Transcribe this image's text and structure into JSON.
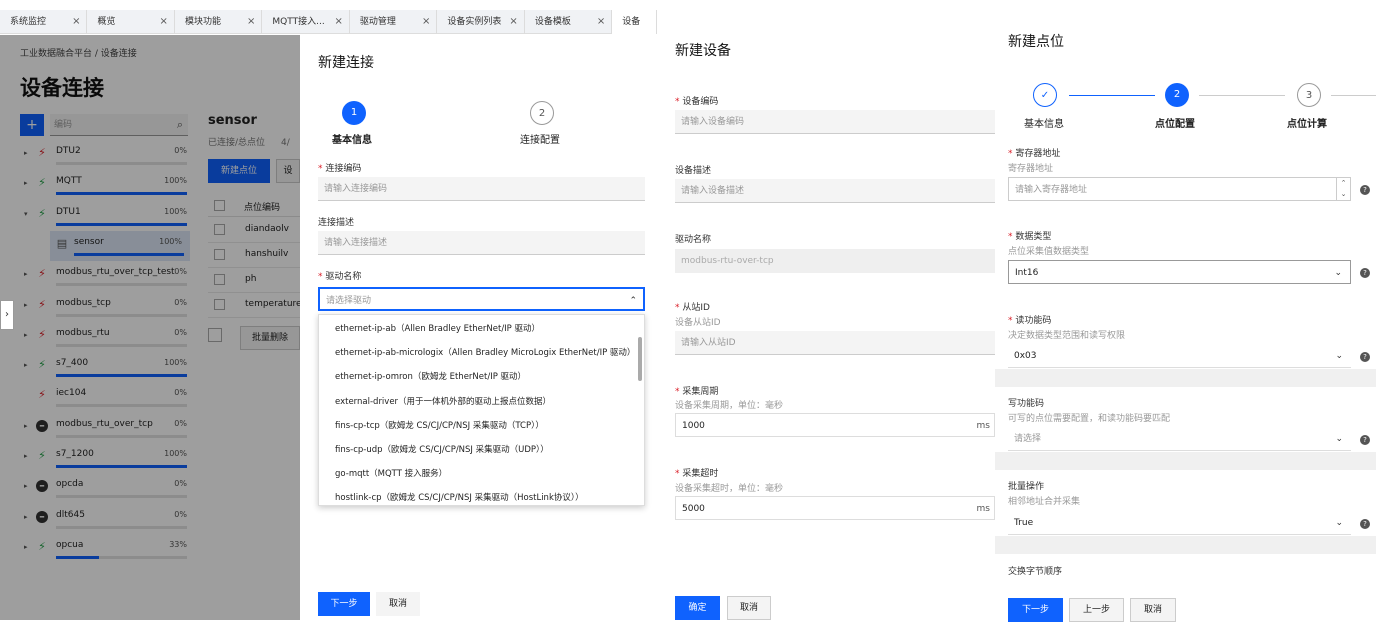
{
  "tabs": [
    {
      "label": "系统监控",
      "active": false
    },
    {
      "label": "概览",
      "active": false
    },
    {
      "label": "模块功能",
      "active": false
    },
    {
      "label": "MQTT接入...",
      "active": false
    },
    {
      "label": "驱动管理",
      "active": false
    },
    {
      "label": "设备实例列表",
      "active": false
    },
    {
      "label": "设备模板",
      "active": false
    },
    {
      "label": "设备",
      "active": true
    }
  ],
  "close_glyph": "×",
  "breadcrumb": "工业数据融合平台 / 设备连接",
  "page_title": "设备连接",
  "search": {
    "placeholder": "编码",
    "add_label": "+"
  },
  "tree": [
    {
      "name": "DTU2",
      "percent": "0%",
      "progress": 0,
      "status": "disconnected",
      "expand": true
    },
    {
      "name": "MQTT",
      "percent": "100%",
      "progress": 1,
      "status": "connected",
      "expand": true
    },
    {
      "name": "DTU1",
      "percent": "100%",
      "progress": 1,
      "status": "connected",
      "expand": true,
      "open": true
    },
    {
      "name": "sensor",
      "percent": "100%",
      "progress": 1,
      "status": "device",
      "expand": false,
      "child": true
    },
    {
      "name": "modbus_rtu_over_tcp_test",
      "percent": "0%",
      "progress": 0,
      "status": "disconnected",
      "expand": true
    },
    {
      "name": "modbus_tcp",
      "percent": "0%",
      "progress": 0,
      "status": "disconnected",
      "expand": true
    },
    {
      "name": "modbus_rtu",
      "percent": "0%",
      "progress": 0,
      "status": "disconnected",
      "expand": true
    },
    {
      "name": "s7_400",
      "percent": "100%",
      "progress": 1,
      "status": "connected",
      "expand": true
    },
    {
      "name": "iec104",
      "percent": "0%",
      "progress": 0,
      "status": "disconnected",
      "expand": false
    },
    {
      "name": "modbus_rtu_over_tcp",
      "percent": "0%",
      "progress": 0,
      "status": "stopped",
      "expand": true
    },
    {
      "name": "s7_1200",
      "percent": "100%",
      "progress": 1,
      "status": "connected",
      "expand": true
    },
    {
      "name": "opcda",
      "percent": "0%",
      "progress": 0,
      "status": "stopped",
      "expand": true
    },
    {
      "name": "dlt645",
      "percent": "0%",
      "progress": 0,
      "status": "stopped",
      "expand": true
    },
    {
      "name": "opcua",
      "percent": "33%",
      "progress": 0.33,
      "status": "connected",
      "expand": true
    }
  ],
  "detail": {
    "title": "sensor",
    "subtitle": "已连接/总点位",
    "count": "4/",
    "new_point_btn": "新建点位",
    "second_btn": "设",
    "col_header": "点位编码",
    "rows": [
      "diandaolv",
      "hanshuilv",
      "ph",
      "temperature"
    ],
    "batch_delete": "批量删除"
  },
  "drawer_new_connection": {
    "title": "新建连接",
    "steps": [
      {
        "num": "1",
        "label": "基本信息"
      },
      {
        "num": "2",
        "label": "连接配置"
      }
    ],
    "fields": [
      {
        "label": "连接编码",
        "required": true,
        "placeholder": "请输入连接编码"
      },
      {
        "label": "连接描述",
        "required": false,
        "placeholder": "请输入连接描述"
      },
      {
        "label": "驱动名称",
        "required": true,
        "placeholder": "请选择驱动"
      }
    ],
    "dropdown_options": [
      "ethernet-ip-ab（Allen Bradley EtherNet/IP 驱动）",
      "ethernet-ip-ab-micrologix（Allen Bradley MicroLogix EtherNet/IP 驱动）",
      "ethernet-ip-omron（欧姆龙 EtherNet/IP 驱动）",
      "external-driver（用于一体机外部的驱动上报点位数据）",
      "fins-cp-tcp（欧姆龙 CS/CJ/CP/NSJ 采集驱动（TCP））",
      "fins-cp-udp（欧姆龙 CS/CJ/CP/NSJ 采集驱动（UDP））",
      "go-mqtt（MQTT 接入服务）",
      "hostlink-cp（欧姆龙 CS/CJ/CP/NSJ 采集驱动（HostLink协议））"
    ],
    "next_btn": "下一步",
    "cancel_btn": "取消"
  },
  "drawer_new_device": {
    "title": "新建设备",
    "fields": [
      {
        "label": "设备编码",
        "required": true,
        "hint": "",
        "value": "",
        "placeholder": "请输入设备编码"
      },
      {
        "label": "设备描述",
        "required": false,
        "hint": "",
        "value": "",
        "placeholder": "请输入设备描述"
      },
      {
        "label": "驱动名称",
        "required": false,
        "hint": "",
        "value": "modbus-rtu-over-tcp",
        "placeholder": ""
      },
      {
        "label": "从站ID",
        "required": true,
        "hint": "设备从站ID",
        "value": "",
        "placeholder": "请输入从站ID"
      },
      {
        "label": "采集周期",
        "required": true,
        "hint": "设备采集周期，单位：毫秒",
        "value": "1000",
        "unit": "ms"
      },
      {
        "label": "采集超时",
        "required": true,
        "hint": "设备采集超时，单位：毫秒",
        "value": "5000",
        "unit": "ms"
      }
    ],
    "confirm_btn": "确定",
    "cancel_btn": "取消"
  },
  "drawer_new_point": {
    "title": "新建点位",
    "steps": [
      {
        "num": "✓",
        "label": "基本信息",
        "state": "done"
      },
      {
        "num": "2",
        "label": "点位配置",
        "state": "active"
      },
      {
        "num": "3",
        "label": "点位计算",
        "state": "todo"
      }
    ],
    "fields": [
      {
        "label": "寄存器地址",
        "required": true,
        "hint": "寄存器地址",
        "value": "",
        "placeholder": "请输入寄存器地址",
        "type": "number"
      },
      {
        "label": "数据类型",
        "required": true,
        "hint": "点位采集值数据类型",
        "value": "Int16",
        "type": "select"
      },
      {
        "label": "读功能码",
        "required": true,
        "hint": "决定数据类型范围和读写权限",
        "value": "0x03",
        "type": "select"
      },
      {
        "label": "写功能码",
        "required": false,
        "hint": "可写的点位需要配置，和读功能码要匹配",
        "value": "",
        "placeholder": "请选择",
        "type": "select"
      },
      {
        "label": "批量操作",
        "required": false,
        "hint": "相邻地址合并采集",
        "value": "True",
        "type": "select"
      },
      {
        "label": "交换字节顺序",
        "required": false,
        "hint": "",
        "value": "",
        "type": "select"
      }
    ],
    "next_btn": "下一步",
    "prev_btn": "上一步",
    "cancel_btn": "取消"
  },
  "colors": {
    "primary": "#0f62fe",
    "connected": "#24a148",
    "disconnected": "#da1e28",
    "required": "#da1e28"
  }
}
